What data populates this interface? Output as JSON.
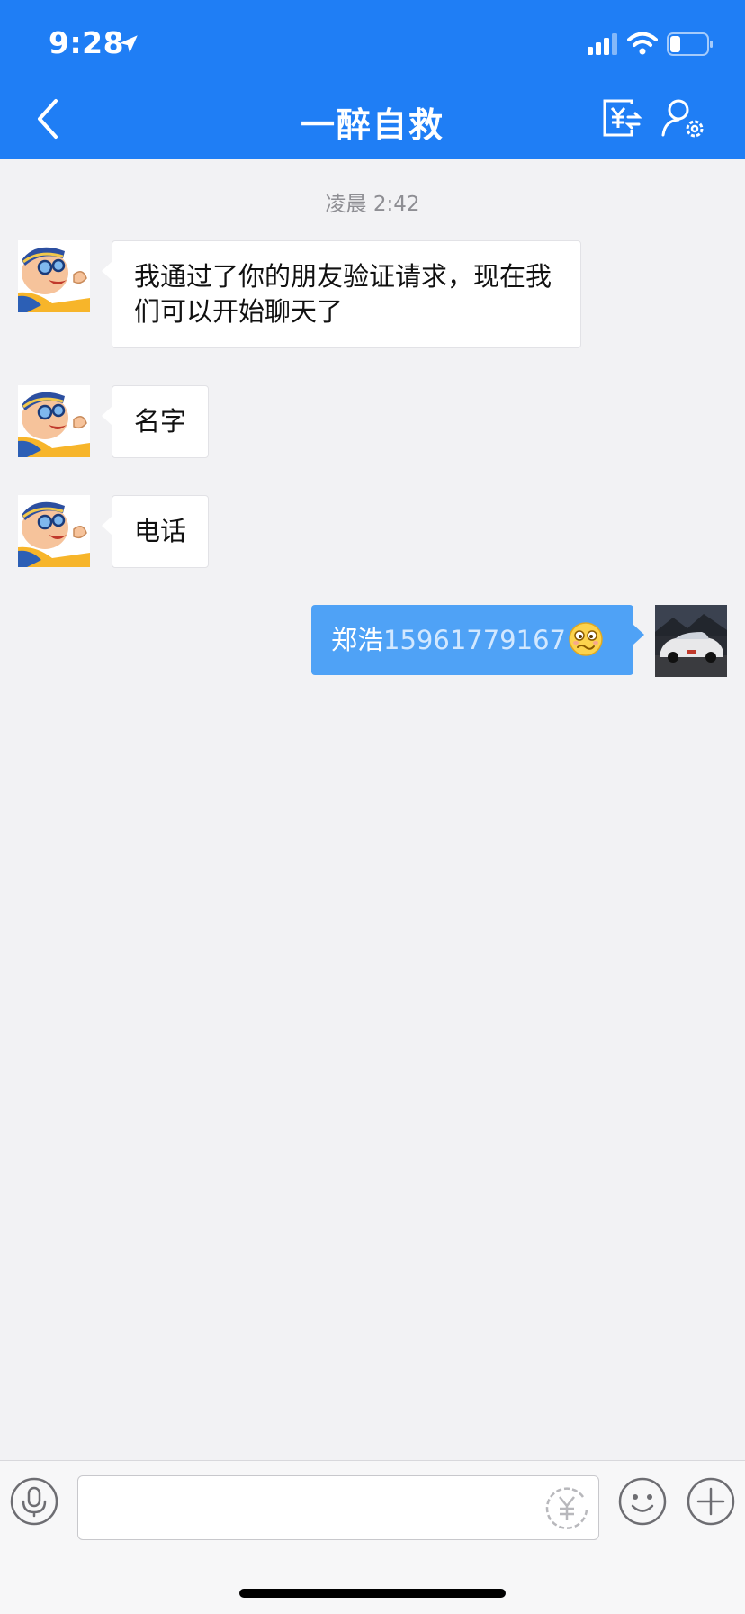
{
  "status_bar": {
    "time": "9:28",
    "icons": [
      "location-arrow-icon",
      "cellular-signal-icon",
      "wifi-icon",
      "battery-icon"
    ]
  },
  "header": {
    "title": "一醉自救",
    "back_icon": "chevron-left-icon",
    "actions": [
      "transfer-money-icon",
      "chat-settings-icon"
    ],
    "background": "#1f7ef5"
  },
  "chat": {
    "timestamp": "凌晨 2:42",
    "messages": [
      {
        "from": "friend",
        "text": "我通过了你的朋友验证请求，现在我们可以开始聊天了"
      },
      {
        "from": "friend",
        "text": "名字"
      },
      {
        "from": "friend",
        "text": "电话"
      },
      {
        "from": "me",
        "name_text": "郑浩",
        "number_text": "15961779167",
        "emoji": "woozy-face-emoji"
      }
    ],
    "colors": {
      "my_bubble": "#4fa2f6",
      "friend_bubble": "#ffffff",
      "number_link": "#d2e8ff"
    }
  },
  "input_bar": {
    "placeholder": "",
    "icons": [
      "microphone-icon",
      "red-packet-icon",
      "smiley-icon",
      "plus-icon"
    ]
  }
}
